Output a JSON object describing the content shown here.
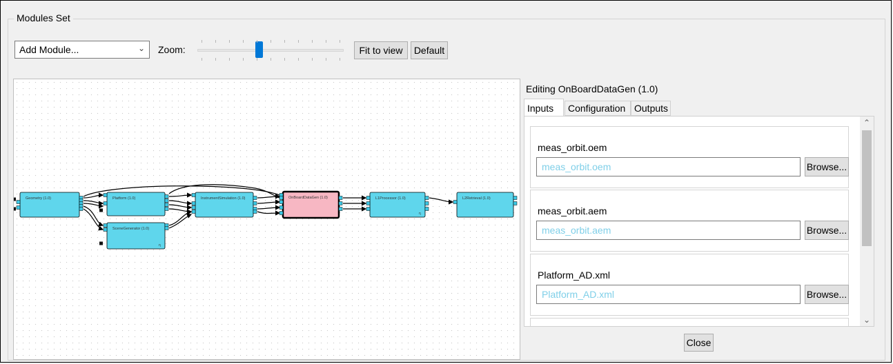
{
  "window": {
    "group_title": "Modules Set"
  },
  "toolbar": {
    "add_module": "Add Module...",
    "zoom_label": "Zoom:",
    "zoom_level": 0.42,
    "fit_label": "Fit to view",
    "default_label": "Default"
  },
  "graph": {
    "nodes": [
      {
        "id": "geometry",
        "label": "Geometry (1.0)",
        "selected": false
      },
      {
        "id": "platform",
        "label": "Platform (1.0)",
        "selected": false
      },
      {
        "id": "scenegenerator",
        "label": "SceneGenerator (1.0)",
        "selected": false
      },
      {
        "id": "instrumentsimulation",
        "label": "InstrumentSimulation (1.0)",
        "selected": false
      },
      {
        "id": "onboarddatagen",
        "label": "OnBoardDataGen (1.0)",
        "selected": true
      },
      {
        "id": "l1processor",
        "label": "L1Processor (1.0)",
        "selected": false
      },
      {
        "id": "l2retrieval",
        "label": "L2Retrieval (1.0)",
        "selected": false
      }
    ],
    "colors": {
      "node": "#5fd6ec",
      "selected": "#f7b7c3",
      "port": "#3cc9e6",
      "edge": "#000000"
    }
  },
  "editor": {
    "title": "Editing OnBoardDataGen (1.0)",
    "tabs": [
      {
        "label": "Inputs",
        "active": true
      },
      {
        "label": "Configuration",
        "active": false
      },
      {
        "label": "Outputs",
        "active": false
      }
    ],
    "inputs": [
      {
        "label": "meas_orbit.oem",
        "value": "meas_orbit.oem",
        "button": "Browse..."
      },
      {
        "label": "meas_orbit.aem",
        "value": "meas_orbit.aem",
        "button": "Browse..."
      },
      {
        "label": "Platform_AD.xml",
        "value": "Platform_AD.xml",
        "button": "Browse..."
      }
    ],
    "close_label": "Close"
  }
}
